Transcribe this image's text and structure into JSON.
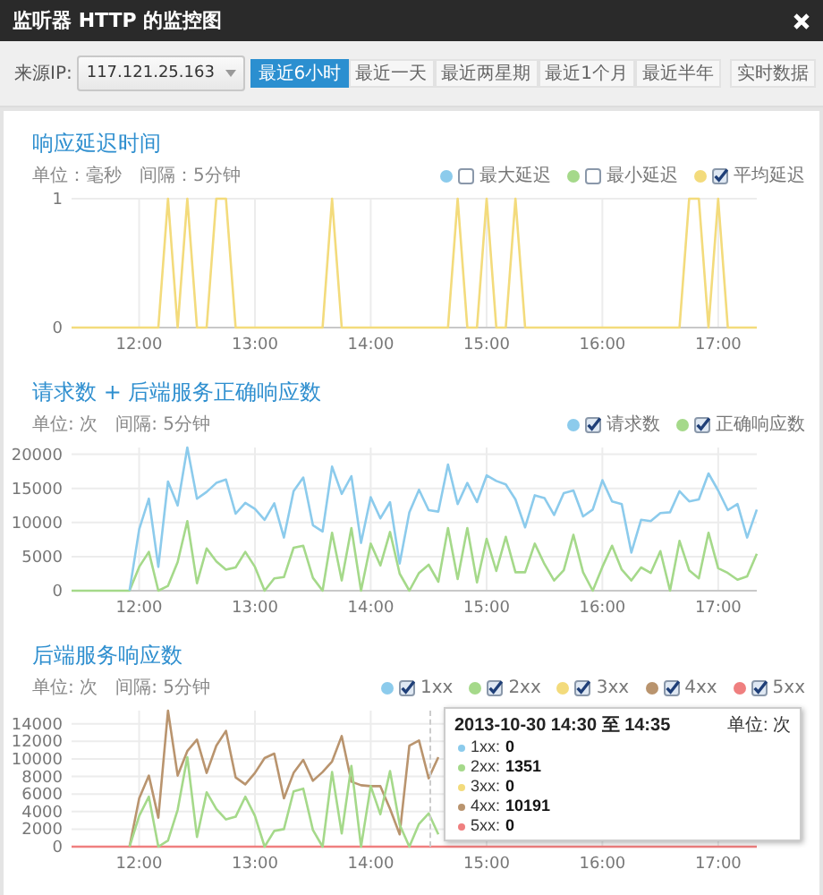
{
  "window": {
    "title": "监听器 HTTP 的监控图"
  },
  "toolbar": {
    "source_label": "来源IP:",
    "source_value": "117.121.25.163",
    "ranges": [
      {
        "label": "最近6小时",
        "selected": true
      },
      {
        "label": "最近一天",
        "selected": false
      },
      {
        "label": "最近两星期",
        "selected": false
      },
      {
        "label": "最近1个月",
        "selected": false
      },
      {
        "label": "最近半年",
        "selected": false
      }
    ],
    "realtime_button": "实时数据"
  },
  "sections": [
    {
      "title": "响应延迟时间",
      "unit": "单位：毫秒",
      "interval": "间隔：5分钟",
      "legend": [
        {
          "checked": false
        },
        {
          "checked": false
        },
        {
          "checked": true
        }
      ],
      "chart_data": {
        "type": "line",
        "grid": true,
        "ylim": [
          0,
          1
        ],
        "yticks": [
          0,
          1
        ],
        "categories": [
          null,
          null,
          null,
          null,
          null,
          null,
          null,
          "12:00",
          null,
          null,
          null,
          null,
          null,
          null,
          null,
          null,
          null,
          null,
          null,
          "13:00",
          null,
          null,
          null,
          null,
          null,
          null,
          null,
          null,
          null,
          null,
          null,
          "14:00",
          null,
          null,
          null,
          null,
          null,
          null,
          null,
          null,
          null,
          null,
          null,
          "15:00",
          null,
          null,
          null,
          null,
          null,
          null,
          null,
          null,
          null,
          null,
          null,
          "16:00",
          null,
          null,
          null,
          null,
          null,
          null,
          null,
          null,
          null,
          null,
          null,
          "17:00",
          null,
          null,
          null,
          null
        ],
        "series": [
          {
            "name": "最大延迟",
            "color": "#8ccbec",
            "values": [
              null,
              null,
              null,
              null,
              null,
              null,
              null,
              null,
              null,
              null,
              null,
              null,
              null,
              null,
              null,
              null,
              null,
              null,
              null,
              null,
              null,
              null,
              null,
              null,
              null,
              null,
              null,
              null,
              null,
              null,
              null,
              null,
              null,
              null,
              null,
              null,
              null,
              null,
              null,
              null,
              null,
              null,
              null,
              null,
              null,
              null,
              null,
              null,
              null,
              null,
              null,
              null,
              null,
              null,
              null,
              null,
              null,
              null,
              null,
              null,
              null,
              null,
              null,
              null,
              null,
              null,
              null,
              null,
              null,
              null,
              null,
              null
            ]
          },
          {
            "name": "最小延迟",
            "color": "#a5d98a",
            "values": [
              null,
              null,
              null,
              null,
              null,
              null,
              null,
              null,
              null,
              null,
              null,
              null,
              null,
              null,
              null,
              null,
              null,
              null,
              null,
              null,
              null,
              null,
              null,
              null,
              null,
              null,
              null,
              null,
              null,
              null,
              null,
              null,
              null,
              null,
              null,
              null,
              null,
              null,
              null,
              null,
              null,
              null,
              null,
              null,
              null,
              null,
              null,
              null,
              null,
              null,
              null,
              null,
              null,
              null,
              null,
              null,
              null,
              null,
              null,
              null,
              null,
              null,
              null,
              null,
              null,
              null,
              null,
              null,
              null,
              null,
              null,
              null
            ]
          },
          {
            "name": "平均延迟",
            "color": "#f3db7c",
            "values": [
              0,
              0,
              0,
              0,
              0,
              0,
              0,
              0,
              0,
              0,
              1,
              0,
              1,
              0,
              0,
              1,
              1,
              0,
              0,
              0,
              0,
              0,
              0,
              0,
              0,
              0,
              0,
              1,
              0,
              0,
              0,
              0,
              0,
              0,
              0,
              0,
              0,
              0,
              0,
              0,
              1,
              0,
              0,
              1,
              0,
              0,
              1,
              0,
              0,
              0,
              0,
              0,
              0,
              0,
              0,
              0,
              0,
              0,
              0,
              0,
              0,
              0,
              0,
              0,
              1,
              1,
              0,
              1,
              0,
              0,
              0,
              0
            ]
          }
        ]
      }
    },
    {
      "title": "请求数 + 后端服务正确响应数",
      "unit": "单位: 次",
      "interval": "间隔: 5分钟",
      "legend": [
        {
          "checked": true
        },
        {
          "checked": true
        }
      ],
      "chart_data": {
        "type": "line",
        "grid": true,
        "ylim": [
          0,
          21000
        ],
        "yticks": [
          0,
          5000,
          10000,
          15000,
          20000
        ],
        "categories": [
          null,
          null,
          null,
          null,
          null,
          null,
          null,
          "12:00",
          null,
          null,
          null,
          null,
          null,
          null,
          null,
          null,
          null,
          null,
          null,
          "13:00",
          null,
          null,
          null,
          null,
          null,
          null,
          null,
          null,
          null,
          null,
          null,
          "14:00",
          null,
          null,
          null,
          null,
          null,
          null,
          null,
          null,
          null,
          null,
          null,
          "15:00",
          null,
          null,
          null,
          null,
          null,
          null,
          null,
          null,
          null,
          null,
          null,
          "16:00",
          null,
          null,
          null,
          null,
          null,
          null,
          null,
          null,
          null,
          null,
          null,
          "17:00",
          null,
          null,
          null,
          null
        ],
        "series": [
          {
            "name": "请求数",
            "color": "#8ccbec",
            "values": [
              null,
              null,
              null,
              null,
              null,
              null,
              0,
              9000,
              13500,
              3500,
              16000,
              12500,
              21000,
              13500,
              14500,
              15800,
              16300,
              11300,
              12900,
              12000,
              10400,
              12800,
              7800,
              14600,
              16600,
              9600,
              8700,
              18200,
              14200,
              16800,
              7000,
              13700,
              10600,
              13000,
              4000,
              11500,
              14800,
              11800,
              11600,
              18500,
              12700,
              15800,
              13000,
              16900,
              16100,
              15600,
              13400,
              9300,
              14000,
              13600,
              11100,
              14300,
              14700,
              10900,
              11900,
              16200,
              13100,
              12700,
              5600,
              10400,
              10200,
              11400,
              11500,
              14600,
              13100,
              13400,
              17200,
              14700,
              11800,
              12700,
              7800,
              11900
            ]
          },
          {
            "name": "正确响应数",
            "color": "#a5d98a",
            "values": [
              0,
              0,
              0,
              0,
              0,
              0,
              0,
              3500,
              5700,
              0,
              700,
              4200,
              10200,
              1100,
              6200,
              4300,
              3100,
              3400,
              5700,
              3500,
              0,
              1800,
              2000,
              6300,
              6600,
              1900,
              0,
              8500,
              1500,
              9200,
              0,
              6900,
              3700,
              8600,
              2500,
              0,
              2600,
              3800,
              1300,
              9200,
              1700,
              9200,
              1200,
              7600,
              2900,
              7900,
              2700,
              2700,
              6900,
              3900,
              1500,
              3000,
              8200,
              2700,
              0,
              3500,
              6600,
              3100,
              1500,
              3400,
              2600,
              5800,
              0,
              7300,
              3000,
              1800,
              8500,
              3300,
              2600,
              1600,
              2100,
              5400
            ]
          }
        ]
      }
    },
    {
      "title": "后端服务响应数",
      "unit": "单位: 次",
      "interval": "间隔: 5分钟",
      "legend": [
        {
          "checked": true
        },
        {
          "checked": true
        },
        {
          "checked": true
        },
        {
          "checked": true
        },
        {
          "checked": true
        }
      ],
      "chart_data": {
        "type": "line",
        "grid": true,
        "ylim": [
          0,
          15500
        ],
        "yticks": [
          0,
          2000,
          4000,
          6000,
          8000,
          10000,
          12000,
          14000
        ],
        "categories": [
          null,
          null,
          null,
          null,
          null,
          null,
          null,
          "12:00",
          null,
          null,
          null,
          null,
          null,
          null,
          null,
          null,
          null,
          null,
          null,
          "13:00",
          null,
          null,
          null,
          null,
          null,
          null,
          null,
          null,
          null,
          null,
          null,
          "14:00",
          null,
          null,
          null,
          null,
          null,
          null,
          null,
          null,
          null,
          null,
          null,
          "15:00",
          null,
          null,
          null,
          null,
          null,
          null,
          null,
          null,
          null,
          null,
          null,
          "16:00",
          null,
          null,
          null,
          null,
          null,
          null,
          null,
          null,
          null,
          null,
          null,
          "17:00",
          null,
          null,
          null,
          null
        ],
        "series": [
          {
            "name": "1xx",
            "color": "#8ccbec",
            "values": [
              null,
              null,
              null,
              null,
              null,
              null,
              null,
              null,
              null,
              null,
              null,
              null,
              null,
              null,
              null,
              null,
              null,
              null,
              null,
              null,
              null,
              null,
              null,
              null,
              null,
              null,
              null,
              null,
              null,
              null,
              null,
              null,
              null,
              null,
              null,
              null,
              null,
              null,
              null,
              null,
              null,
              null,
              null,
              null,
              null,
              null,
              null,
              null,
              null,
              null,
              null,
              null,
              null,
              null,
              null,
              null,
              null,
              null,
              null,
              null,
              null,
              null,
              null,
              null,
              null,
              null,
              null,
              null,
              null,
              null,
              null,
              null
            ]
          },
          {
            "name": "2xx",
            "color": "#a5d98a",
            "values": [
              null,
              null,
              null,
              null,
              null,
              null,
              0,
              3500,
              5700,
              0,
              700,
              4200,
              10200,
              1100,
              6200,
              4300,
              3100,
              3400,
              5700,
              3500,
              0,
              1800,
              2000,
              6300,
              6600,
              1900,
              0,
              8500,
              1500,
              9200,
              0,
              6900,
              3700,
              8600,
              2500,
              0,
              2600,
              3800,
              1400,
              null,
              null,
              null,
              null,
              null,
              null,
              null,
              null,
              null,
              null,
              null,
              null,
              null,
              null,
              null,
              null,
              null,
              null,
              null,
              null,
              null,
              null,
              null,
              null,
              null,
              null,
              null,
              null,
              null,
              null,
              null,
              null,
              null
            ]
          },
          {
            "name": "3xx",
            "color": "#f3db7c",
            "values": [
              null,
              null,
              null,
              null,
              null,
              null,
              null,
              null,
              null,
              null,
              null,
              null,
              null,
              null,
              null,
              null,
              null,
              null,
              null,
              null,
              null,
              null,
              null,
              null,
              null,
              null,
              null,
              null,
              null,
              null,
              null,
              null,
              null,
              null,
              null,
              null,
              null,
              null,
              null,
              null,
              null,
              null,
              null,
              null,
              null,
              null,
              null,
              null,
              null,
              null,
              null,
              null,
              null,
              null,
              null,
              null,
              null,
              null,
              null,
              null,
              null,
              null,
              null,
              null,
              null,
              null,
              null,
              null,
              null,
              null,
              null,
              null
            ]
          },
          {
            "name": "4xx",
            "color": "#b9946e",
            "values": [
              null,
              null,
              null,
              null,
              null,
              null,
              0,
              5500,
              8100,
              3300,
              15500,
              8100,
              10900,
              12200,
              8400,
              11500,
              13200,
              7900,
              7100,
              8400,
              10100,
              10600,
              5500,
              8400,
              9900,
              7500,
              8500,
              9700,
              12600,
              7400,
              7000,
              6900,
              6900,
              4300,
              1400,
              11500,
              12100,
              7800,
              10200,
              null,
              null,
              null,
              null,
              null,
              null,
              null,
              null,
              null,
              null,
              null,
              null,
              null,
              null,
              null,
              null,
              null,
              null,
              null,
              null,
              null,
              null,
              null,
              null,
              null,
              null,
              null,
              null,
              null,
              null,
              null,
              null,
              null
            ]
          },
          {
            "name": "5xx",
            "color": "#ef7f7f",
            "values": [
              0,
              0,
              0,
              0,
              0,
              0,
              0,
              0,
              0,
              0,
              0,
              0,
              0,
              0,
              0,
              0,
              0,
              0,
              0,
              0,
              0,
              0,
              0,
              0,
              0,
              0,
              0,
              0,
              0,
              0,
              0,
              0,
              0,
              0,
              0,
              0,
              0,
              0,
              0,
              0,
              0,
              0,
              0,
              0,
              0,
              0,
              0,
              0,
              0,
              0,
              0,
              0,
              0,
              0,
              0,
              0,
              0,
              0,
              0,
              0,
              0,
              0,
              0,
              0,
              0,
              0,
              0,
              0,
              0,
              0,
              0,
              0
            ]
          }
        ]
      },
      "tooltip": {
        "title": "2013-10-30 14:30 至 14:35",
        "unit": "单位: 次",
        "rows": [
          {
            "label": "1xx:",
            "value": "0",
            "color": "#8ccbec"
          },
          {
            "label": "2xx:",
            "value": "1351",
            "color": "#a5d98a"
          },
          {
            "label": "3xx:",
            "value": "0",
            "color": "#f3db7c"
          },
          {
            "label": "4xx:",
            "value": "10191",
            "color": "#b9946e"
          },
          {
            "label": "5xx:",
            "value": "0",
            "color": "#ef7f7f"
          }
        ]
      }
    }
  ]
}
